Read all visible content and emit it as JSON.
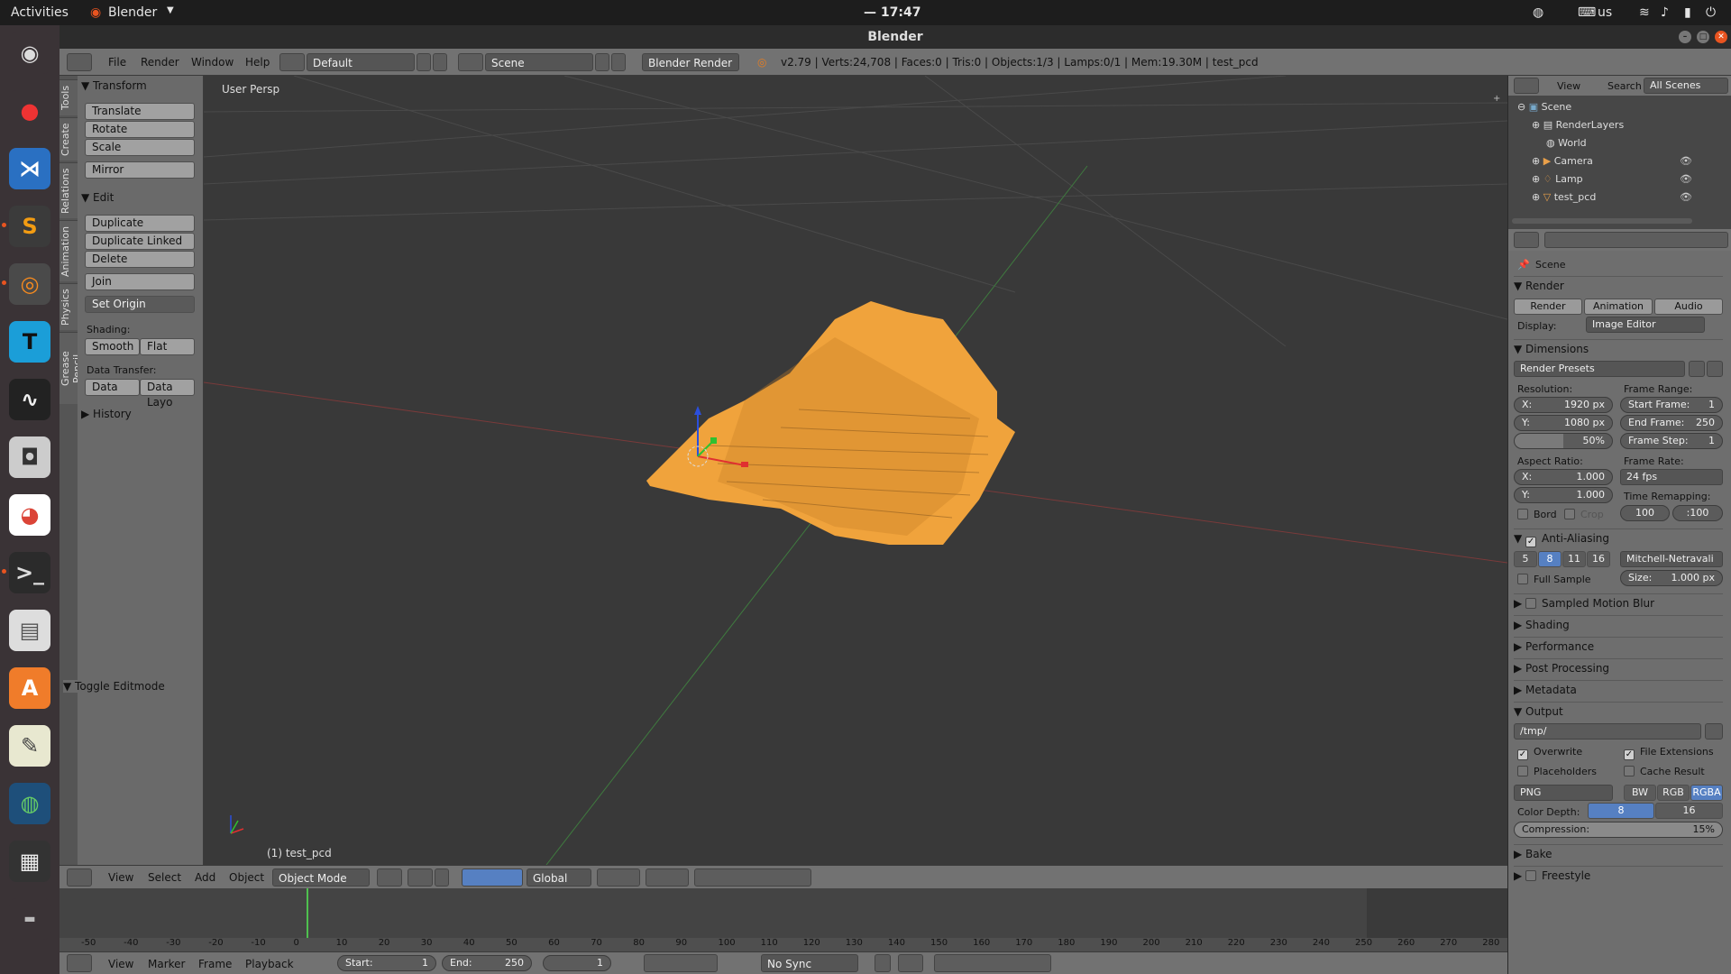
{
  "system_bar": {
    "activities": "Activities",
    "app_menu": "Blender",
    "clock": "— 17:47",
    "keyboard": "us"
  },
  "window": {
    "title": "Blender"
  },
  "header": {
    "menus": [
      "File",
      "Render",
      "Window",
      "Help"
    ],
    "screen_layout": "Default",
    "scene": "Scene",
    "render_engine": "Blender Render",
    "stats": "v2.79 | Verts:24,708 | Faces:0 | Tris:0 | Objects:1/3 | Lamps:0/1 | Mem:19.30M | test_pcd"
  },
  "tool_tabs": [
    "Tools",
    "Create",
    "Relations",
    "Animation",
    "Physics",
    "Grease Pencil"
  ],
  "tools": {
    "transform": {
      "title": "Transform",
      "buttons": [
        "Translate",
        "Rotate",
        "Scale",
        "Mirror"
      ]
    },
    "edit": {
      "title": "Edit",
      "buttons": [
        "Duplicate",
        "Duplicate Linked",
        "Delete",
        "Join"
      ],
      "set_origin": "Set Origin"
    },
    "shading": {
      "label": "Shading:",
      "smooth": "Smooth",
      "flat": "Flat"
    },
    "data_transfer": {
      "label": "Data Transfer:",
      "data": "Data",
      "data_layout": "Data Layo"
    },
    "history": "History",
    "toggle_editmode": "Toggle Editmode"
  },
  "viewport": {
    "view_name": "User Persp",
    "object_label": "(1) test_pcd",
    "point_color": "#f0a33c"
  },
  "view_header": {
    "menus": [
      "View",
      "Select",
      "Add",
      "Object"
    ],
    "mode": "Object Mode",
    "orientation": "Global"
  },
  "timeline": {
    "ticks": [
      "-50",
      "-40",
      "-30",
      "-20",
      "-10",
      "0",
      "10",
      "20",
      "30",
      "40",
      "50",
      "60",
      "70",
      "80",
      "90",
      "100",
      "110",
      "120",
      "130",
      "140",
      "150",
      "160",
      "170",
      "180",
      "190",
      "200",
      "210",
      "220",
      "230",
      "240",
      "250",
      "260",
      "270",
      "280"
    ],
    "menus": [
      "View",
      "Marker",
      "Frame",
      "Playback"
    ],
    "start": "Start:",
    "start_val": "1",
    "end": "End:",
    "end_val": "250",
    "current": "1",
    "sync": "No Sync"
  },
  "outliner": {
    "menus": [
      "View",
      "Search"
    ],
    "filter": "All Scenes",
    "items": [
      "Scene",
      "RenderLayers",
      "World",
      "Camera",
      "Lamp",
      "test_pcd"
    ]
  },
  "properties": {
    "context": "Scene",
    "render": {
      "title": "Render",
      "render_btn": "Render",
      "animation_btn": "Animation",
      "audio_btn": "Audio",
      "display_label": "Display:",
      "display_val": "Image Editor"
    },
    "dimensions": {
      "title": "Dimensions",
      "presets": "Render Presets",
      "resolution_label": "Resolution:",
      "res_x": "X:",
      "res_x_val": "1920 px",
      "res_y": "Y:",
      "res_y_val": "1080 px",
      "res_pct": "50%",
      "frame_range_label": "Frame Range:",
      "start_frame": "Start Frame:",
      "start_frame_val": "1",
      "end_frame": "End Frame:",
      "end_frame_val": "250",
      "frame_step": "Frame Step:",
      "frame_step_val": "1",
      "aspect_label": "Aspect Ratio:",
      "asp_x": "X:",
      "asp_x_val": "1.000",
      "asp_y": "Y:",
      "asp_y_val": "1.000",
      "frame_rate_label": "Frame Rate:",
      "frame_rate": "24 fps",
      "time_remap_label": "Time Remapping:",
      "remap_old": "100",
      "remap_new": ":100",
      "bord": "Bord",
      "crop": "Crop"
    },
    "aa": {
      "title": "Anti-Aliasing",
      "samples": [
        "5",
        "8",
        "11",
        "16"
      ],
      "filter": "Mitchell-Netravali",
      "full_sample": "Full Sample",
      "size": "Size:",
      "size_val": "1.000 px"
    },
    "sections": [
      "Sampled Motion Blur",
      "Shading",
      "Performance",
      "Post Processing",
      "Metadata"
    ],
    "output": {
      "title": "Output",
      "path": "/tmp/",
      "overwrite": "Overwrite",
      "file_ext": "File Extensions",
      "placeholders": "Placeholders",
      "cache": "Cache Result",
      "format": "PNG",
      "bw": "BW",
      "rgb": "RGB",
      "rgba": "RGBA",
      "depth_label": "Color Depth:",
      "depth_8": "8",
      "depth_16": "16",
      "compression": "Compression:",
      "compression_val": "15%"
    },
    "bake": "Bake",
    "freestyle": "Freestyle"
  }
}
